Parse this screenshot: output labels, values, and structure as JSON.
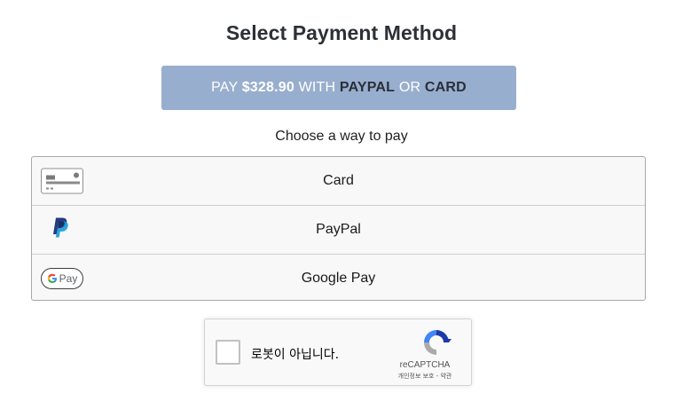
{
  "page": {
    "title": "Select Payment Method",
    "subtitle": "Choose a way to pay"
  },
  "pay_button": {
    "prefix": "PAY ",
    "amount": "$328.90",
    "middle": " WITH ",
    "paypal": "PAYPAL",
    "or": " OR ",
    "card": "CARD"
  },
  "methods": [
    {
      "label": "Card",
      "icon": "credit-card-icon"
    },
    {
      "label": "PayPal",
      "icon": "paypal-icon"
    },
    {
      "label": "Google Pay",
      "icon": "google-pay-icon"
    }
  ],
  "google_pay_badge": {
    "text": "Pay"
  },
  "recaptcha": {
    "checkbox_label": "로봇이 아닙니다.",
    "brand": "reCAPTCHA",
    "privacy": "개인정보 보호",
    "separator": " - ",
    "terms": "약관"
  },
  "colors": {
    "pay_button_bg": "#98aece",
    "title": "#2d3136"
  }
}
